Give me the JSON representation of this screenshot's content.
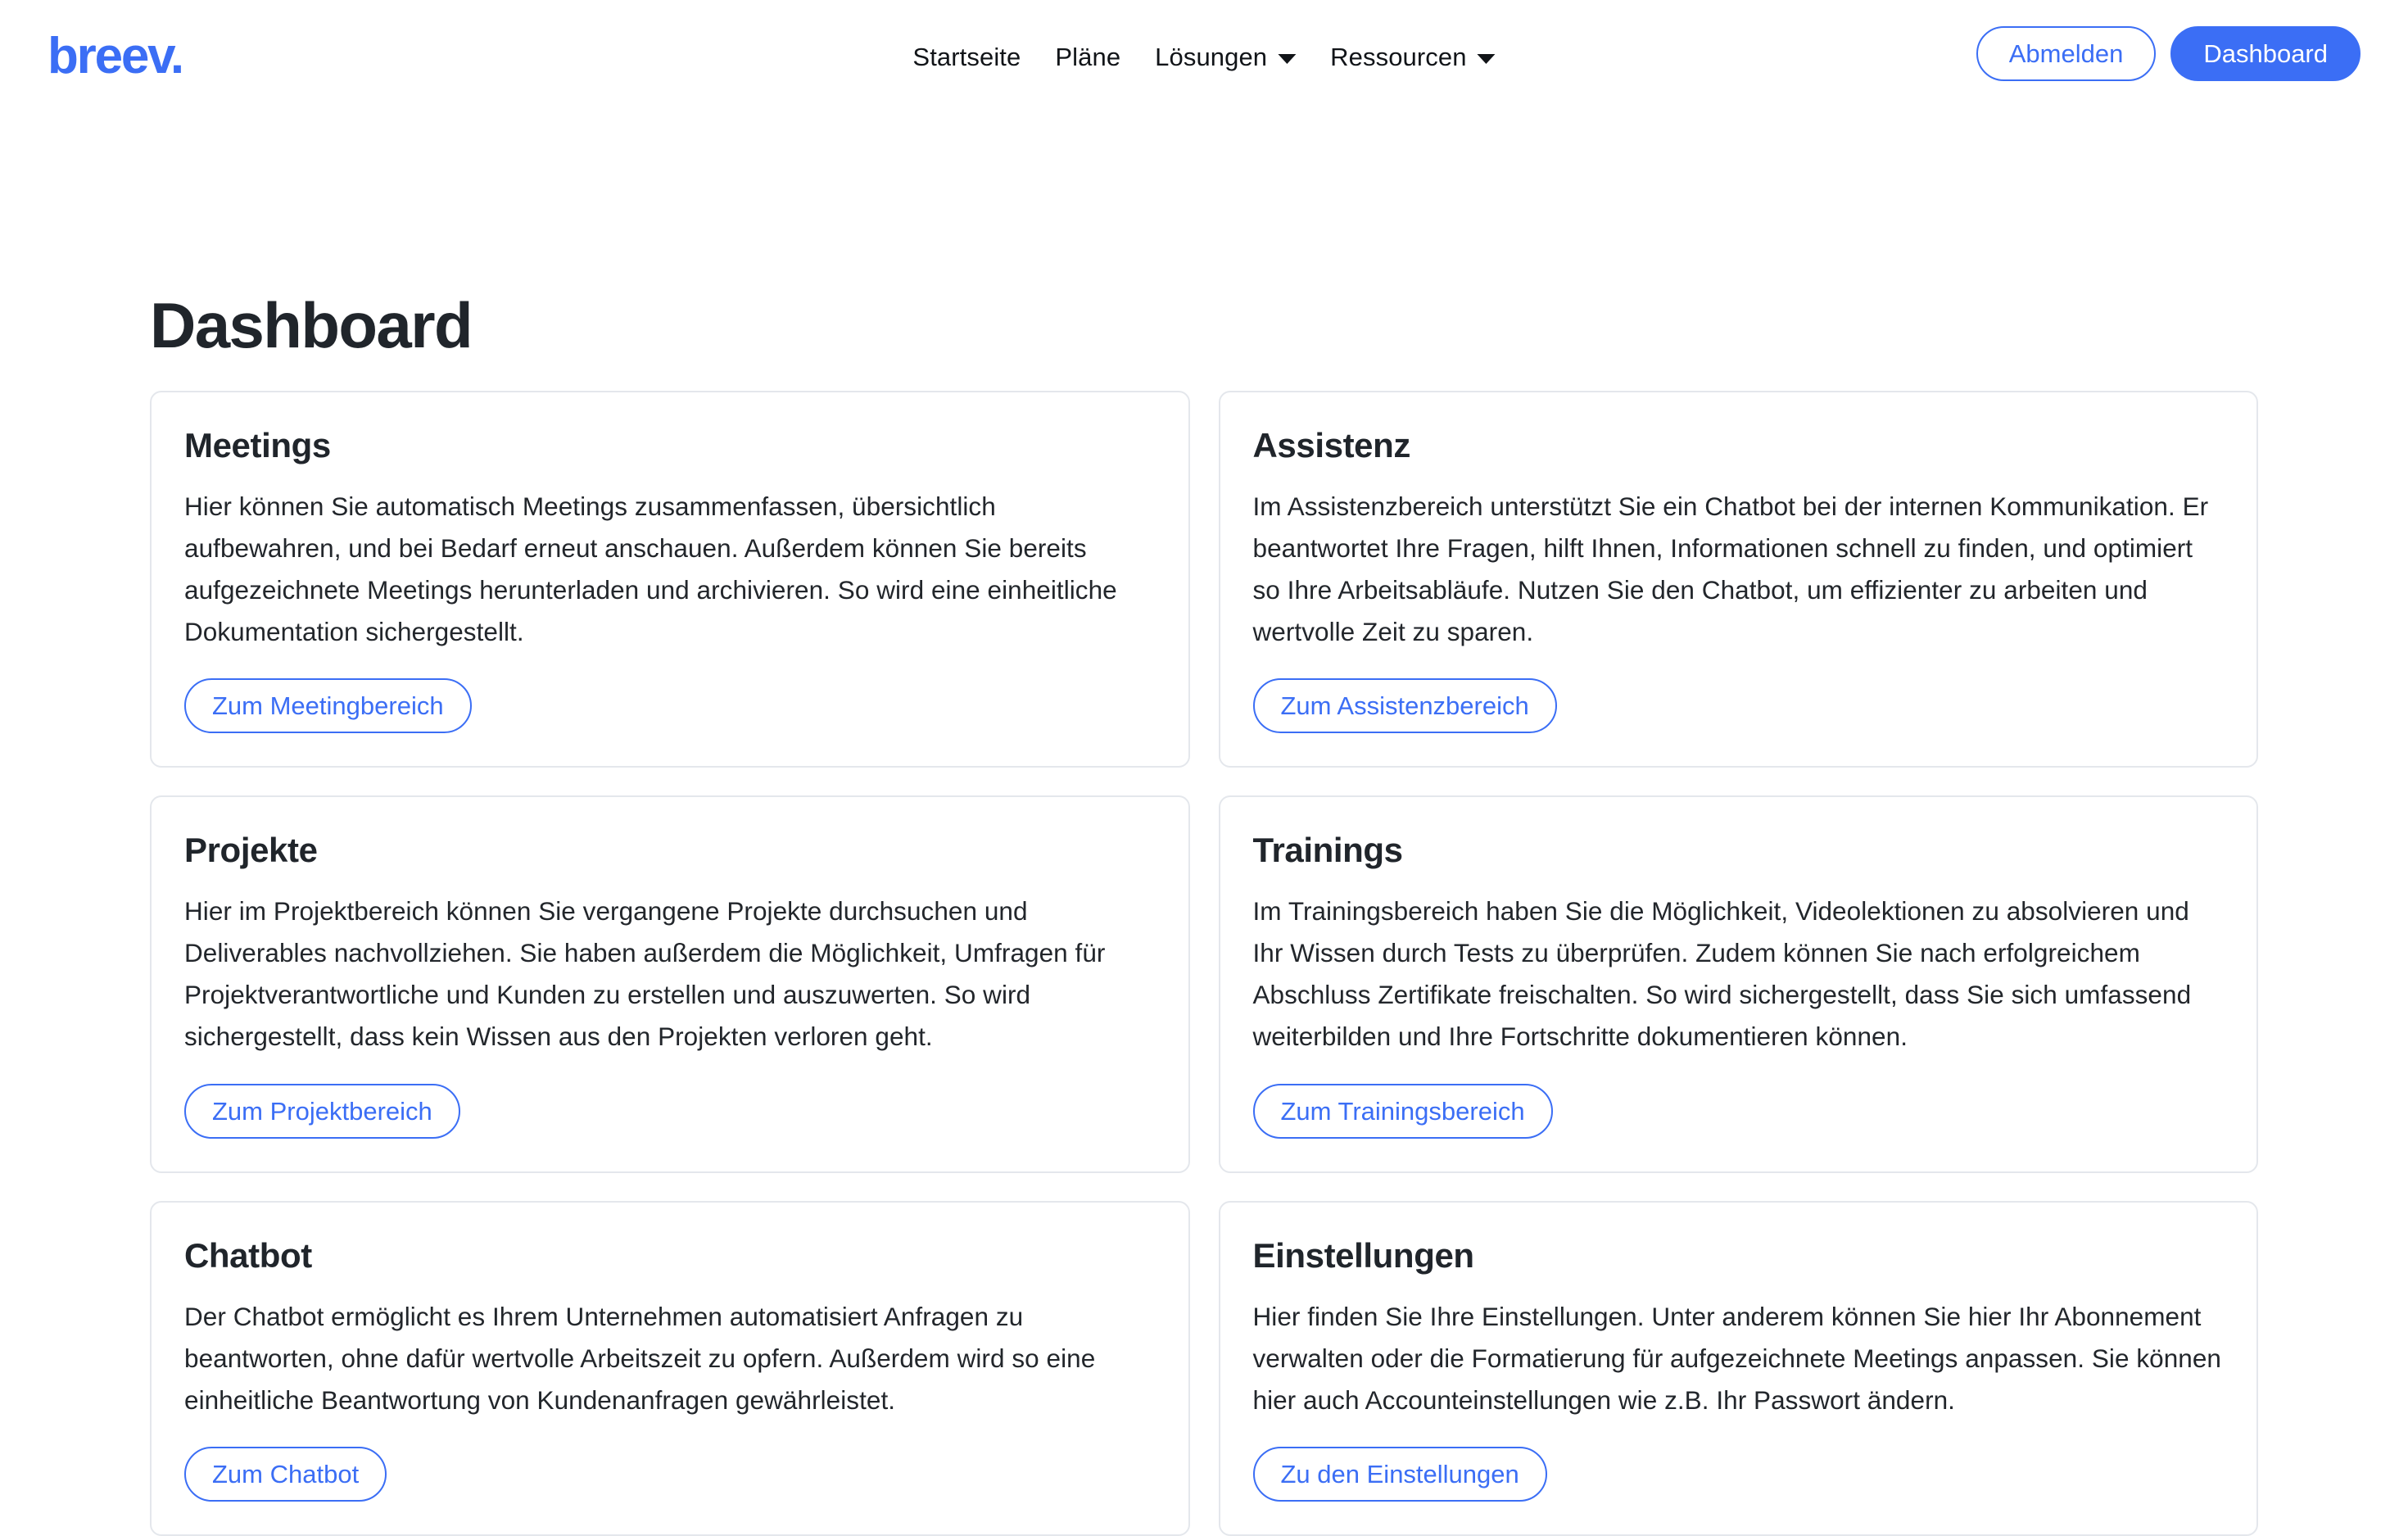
{
  "brand": {
    "name": "breev."
  },
  "nav": {
    "items": [
      {
        "label": "Startseite",
        "has_dropdown": false
      },
      {
        "label": "Pläne",
        "has_dropdown": false
      },
      {
        "label": "Lösungen",
        "has_dropdown": true
      },
      {
        "label": "Ressourcen",
        "has_dropdown": true
      }
    ],
    "actions": {
      "logout_label": "Abmelden",
      "dashboard_label": "Dashboard"
    }
  },
  "page": {
    "title": "Dashboard"
  },
  "cards": [
    {
      "title": "Meetings",
      "text": "Hier können Sie automatisch Meetings zusammenfassen, übersichtlich aufbewahren, und bei Bedarf erneut anschauen. Außerdem können Sie bereits aufgezeichnete Meetings herunterladen und archivieren. So wird eine einheitliche Dokumentation sichergestellt.",
      "button": "Zum Meetingbereich"
    },
    {
      "title": "Assistenz",
      "text": "Im Assistenzbereich unterstützt Sie ein Chatbot bei der internen Kommunikation. Er beantwortet Ihre Fragen, hilft Ihnen, Informationen schnell zu finden, und optimiert so Ihre Arbeitsabläufe. Nutzen Sie den Chatbot, um effizienter zu arbeiten und wertvolle Zeit zu sparen.",
      "button": "Zum Assistenzbereich"
    },
    {
      "title": "Projekte",
      "text": "Hier im Projektbereich können Sie vergangene Projekte durchsuchen und Deliverables nachvollziehen. Sie haben außerdem die Möglichkeit, Umfragen für Projektverantwortliche und Kunden zu erstellen und auszuwerten. So wird sichergestellt, dass kein Wissen aus den Projekten verloren geht.",
      "button": "Zum Projektbereich"
    },
    {
      "title": "Trainings",
      "text": "Im Trainingsbereich haben Sie die Möglichkeit, Videolektionen zu absolvieren und Ihr Wissen durch Tests zu überprüfen. Zudem können Sie nach erfolgreichem Abschluss Zertifikate freischalten. So wird sichergestellt, dass Sie sich umfassend weiterbilden und Ihre Fortschritte dokumentieren können.",
      "button": "Zum Trainingsbereich"
    },
    {
      "title": "Chatbot",
      "text": "Der Chatbot ermöglicht es Ihrem Unternehmen automatisiert Anfragen zu beantworten, ohne dafür wertvolle Arbeitszeit zu opfern. Außerdem wird so eine einheitliche Beantwortung von Kundenanfragen gewährleistet.",
      "button": "Zum Chatbot"
    },
    {
      "title": "Einstellungen",
      "text": "Hier finden Sie Ihre Einstellungen. Unter anderem können Sie hier Ihr Abonnement verwalten oder die Formatierung für aufgezeichnete Meetings anpassen. Sie können hier auch Accounteinstellungen wie z.B. Ihr Passwort ändern.",
      "button": "Zu den Einstellungen"
    }
  ],
  "colors": {
    "brand_blue": "#3b6ef5",
    "text_dark": "#20252b",
    "card_border": "#e4e7ec",
    "background": "#ffffff"
  }
}
